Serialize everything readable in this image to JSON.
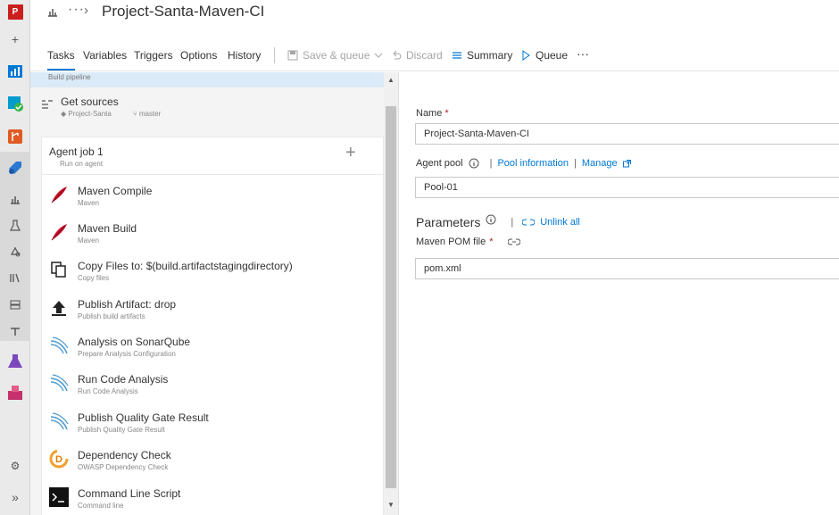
{
  "rail": {
    "project_initial": "P",
    "icons": [
      "project-avatar",
      "plus-icon",
      "boards-icon",
      "check-icon",
      "repos-icon",
      "pipelines-icon",
      "builds-icon",
      "releases-icon",
      "library-icon",
      "task-groups-icon",
      "deployment-groups-icon",
      "test-plans-icon",
      "artifacts-icon",
      "settings-icon",
      "expand-icon"
    ],
    "colors": {
      "project": "#cc1e1e",
      "boards": "#0078d4",
      "test": "#7b48bd",
      "artifacts": "#c4316c"
    }
  },
  "header": {
    "dots": "···",
    "chevron": "›",
    "title": "Project-Santa-Maven-CI"
  },
  "toolbar": {
    "tabs": [
      "Tasks",
      "Variables",
      "Triggers",
      "Options",
      "History"
    ],
    "save_queue": "Save & queue",
    "discard": "Discard",
    "summary": "Summary",
    "queue": "Queue",
    "more": "···"
  },
  "pipeline": {
    "header_label": "Build pipeline",
    "get_sources": {
      "title": "Get sources",
      "repo": "Project-Santa",
      "branch": "master"
    },
    "agent_job": {
      "title": "Agent job 1",
      "subtitle": "Run on agent",
      "add": "+"
    },
    "tasks": [
      {
        "name": "Maven Compile",
        "subtitle": "Maven",
        "icon": "maven-feather-icon"
      },
      {
        "name": "Maven Build",
        "subtitle": "Maven",
        "icon": "maven-feather-icon"
      },
      {
        "name": "Copy Files to: $(build.artifactstagingdirectory)",
        "subtitle": "Copy files",
        "icon": "copy-files-icon"
      },
      {
        "name": "Publish Artifact: drop",
        "subtitle": "Publish build artifacts",
        "icon": "upload-icon"
      },
      {
        "name": "Analysis on SonarQube",
        "subtitle": "Prepare Analysis Configuration",
        "icon": "sonarqube-icon"
      },
      {
        "name": "Run Code Analysis",
        "subtitle": "Run Code Analysis",
        "icon": "sonarqube-icon"
      },
      {
        "name": "Publish Quality Gate Result",
        "subtitle": "Publish Quality Gate Result",
        "icon": "sonarqube-icon"
      },
      {
        "name": "Dependency Check",
        "subtitle": "OWASP Dependency Check",
        "icon": "dependency-check-icon"
      },
      {
        "name": "Command Line Script",
        "subtitle": "Command line",
        "icon": "terminal-icon"
      }
    ]
  },
  "form": {
    "name_label": "Name",
    "name_value": "Project-Santa-Maven-CI",
    "agent_pool_label": "Agent pool",
    "pool_information": "Pool information",
    "manage": "Manage",
    "agent_pool_value": "Pool-01",
    "parameters_title": "Parameters",
    "unlink_all": "Unlink all",
    "pom_label": "Maven POM file",
    "pom_value": "pom.xml",
    "required_mark": "*",
    "separator": "|"
  }
}
